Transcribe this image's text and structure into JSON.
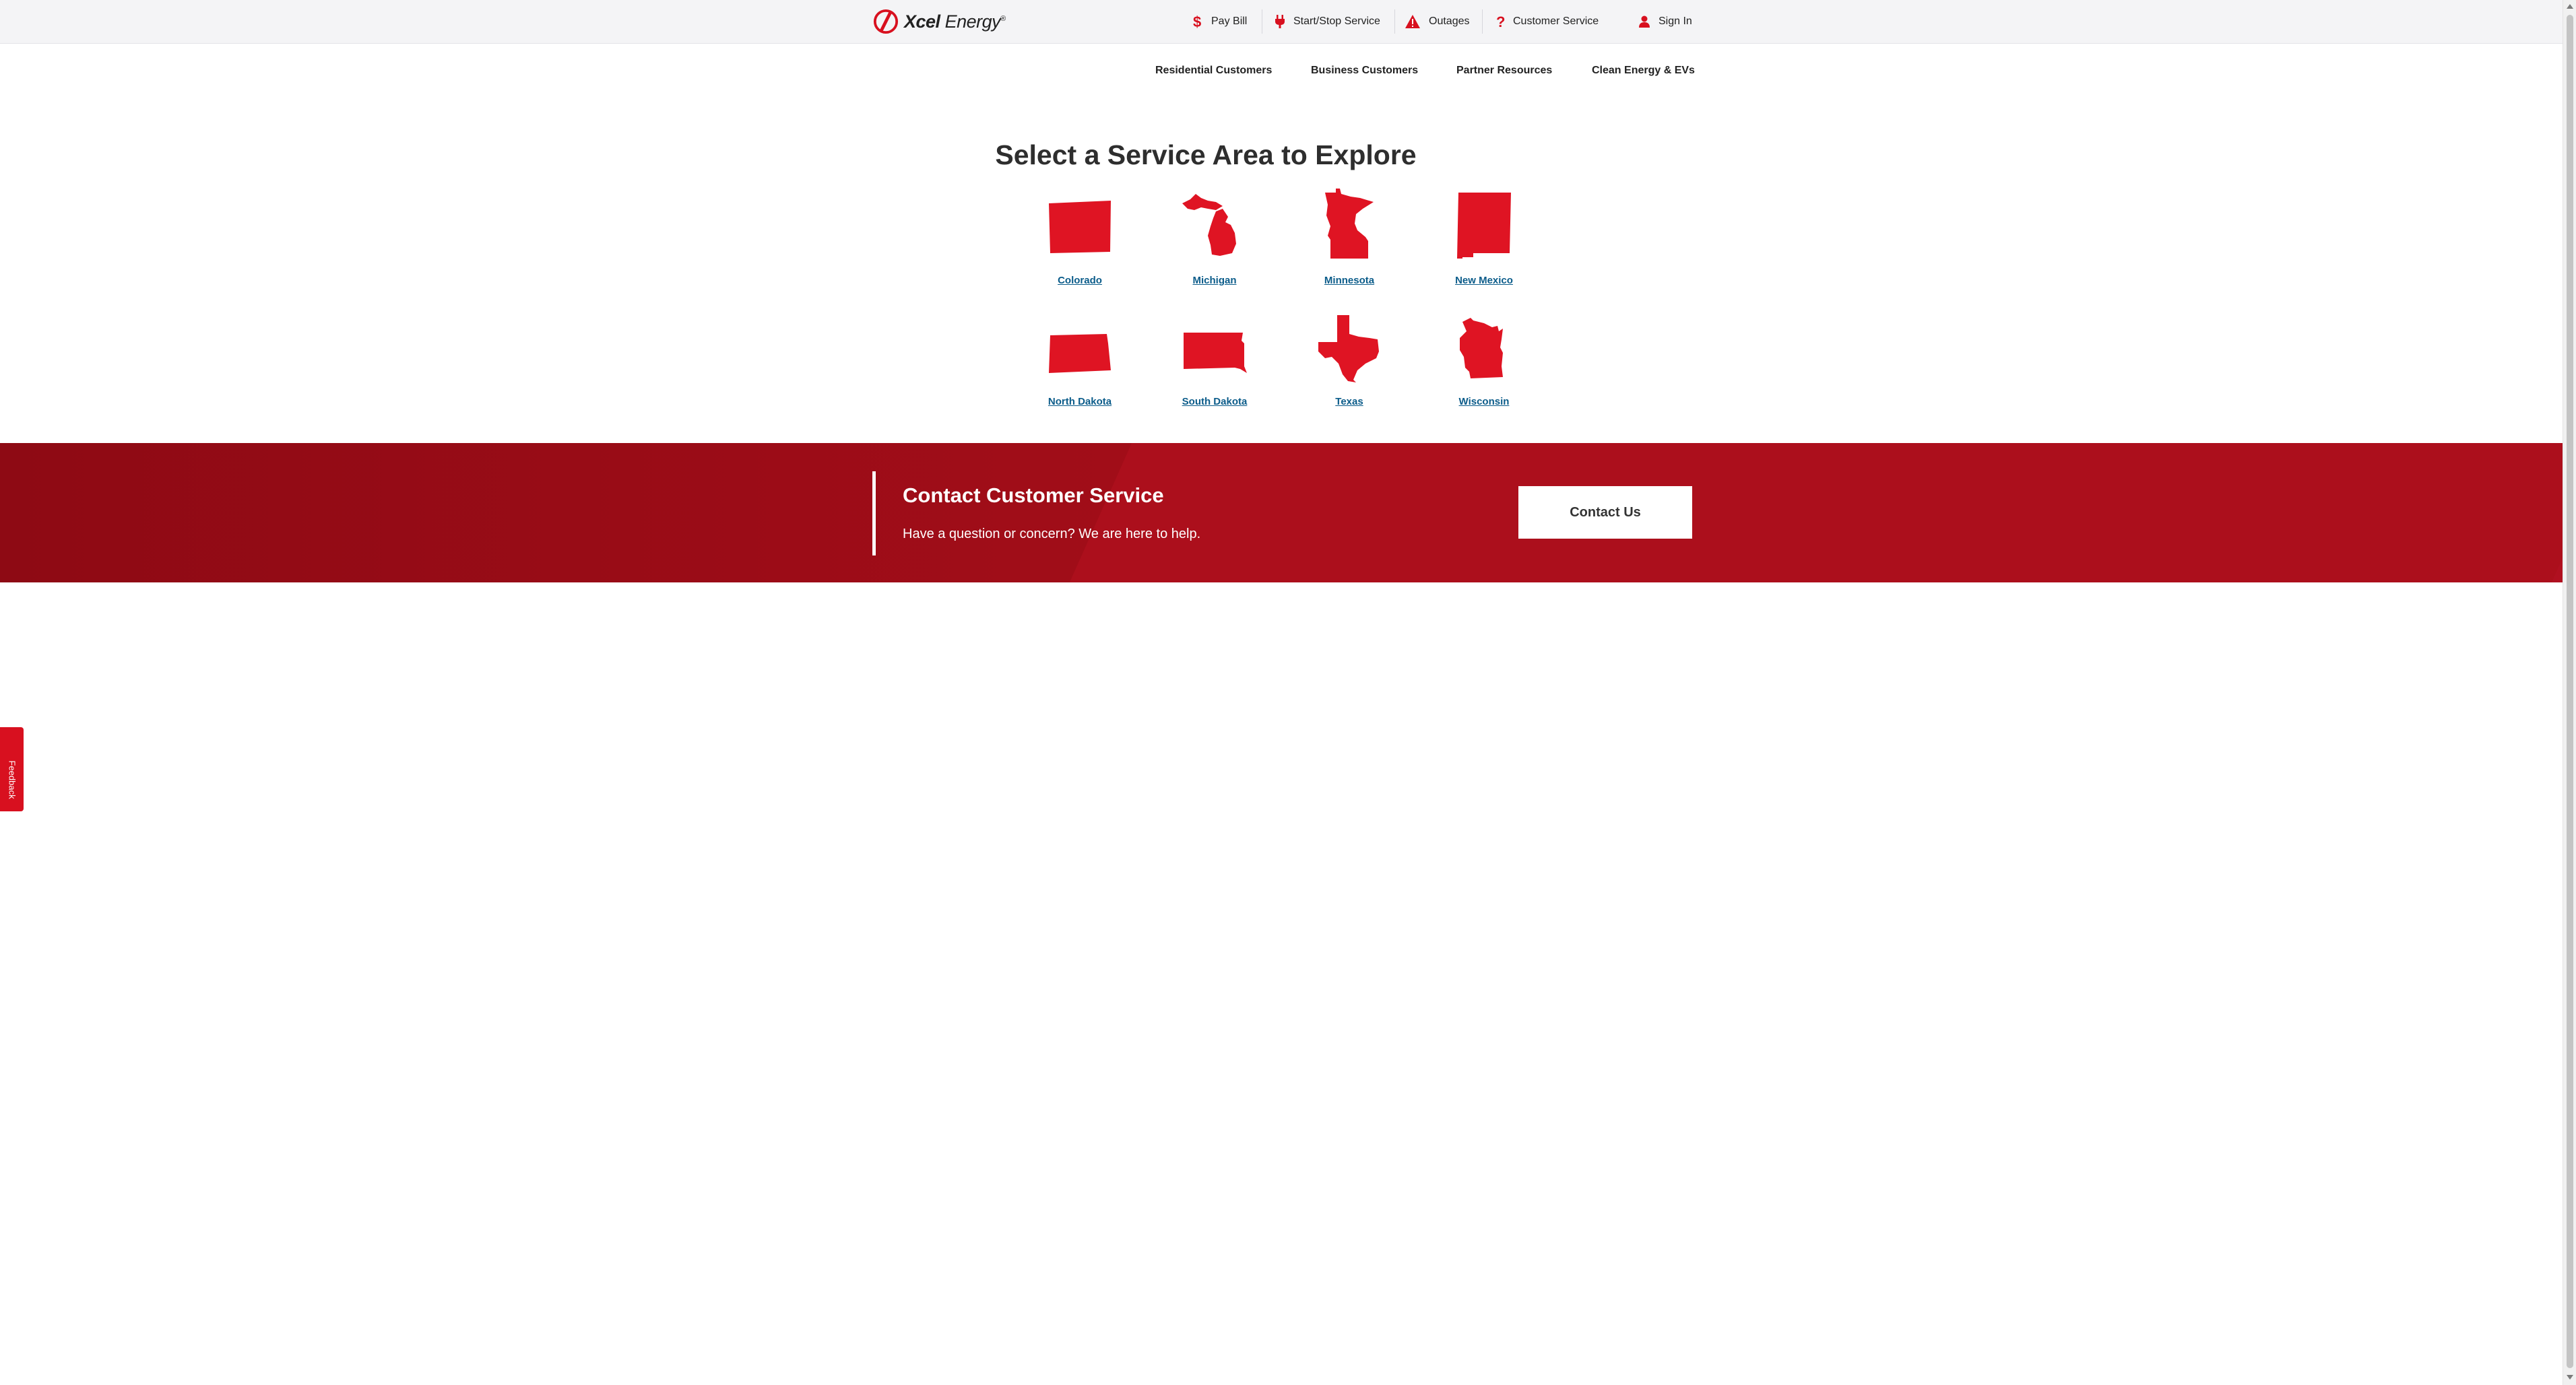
{
  "brand": {
    "name_bold": "Xcel",
    "name_rest": "Energy",
    "trademark": "®",
    "color": "#d8101f"
  },
  "utility_nav": [
    {
      "label": "Pay Bill",
      "icon": "dollar-icon"
    },
    {
      "label": "Start/Stop Service",
      "icon": "power-plug-icon"
    },
    {
      "label": "Outages",
      "icon": "warning-triangle-icon"
    },
    {
      "label": "Customer Service",
      "icon": "question-mark-icon"
    },
    {
      "label": "Sign In",
      "icon": "user-icon"
    }
  ],
  "main_nav": [
    {
      "label": "Residential Customers"
    },
    {
      "label": "Business Customers"
    },
    {
      "label": "Partner Resources"
    },
    {
      "label": "Clean Energy & EVs"
    }
  ],
  "heading": "Select a Service Area to Explore",
  "states": [
    {
      "label": "Colorado",
      "icon": "colorado-map-icon"
    },
    {
      "label": "Michigan",
      "icon": "michigan-map-icon"
    },
    {
      "label": "Minnesota",
      "icon": "minnesota-map-icon"
    },
    {
      "label": "New Mexico",
      "icon": "new-mexico-map-icon"
    },
    {
      "label": "North Dakota",
      "icon": "north-dakota-map-icon"
    },
    {
      "label": "South Dakota",
      "icon": "south-dakota-map-icon"
    },
    {
      "label": "Texas",
      "icon": "texas-map-icon"
    },
    {
      "label": "Wisconsin",
      "icon": "wisconsin-map-icon"
    }
  ],
  "contact_banner": {
    "title": "Contact Customer Service",
    "subtitle": "Have a question or concern? We are here to help.",
    "button_label": "Contact Us"
  },
  "feedback_tab": {
    "label": "Feedback"
  },
  "colors": {
    "accent_red": "#d8101f",
    "banner_red": "#a00d18",
    "link_blue": "#0b5c8a"
  }
}
